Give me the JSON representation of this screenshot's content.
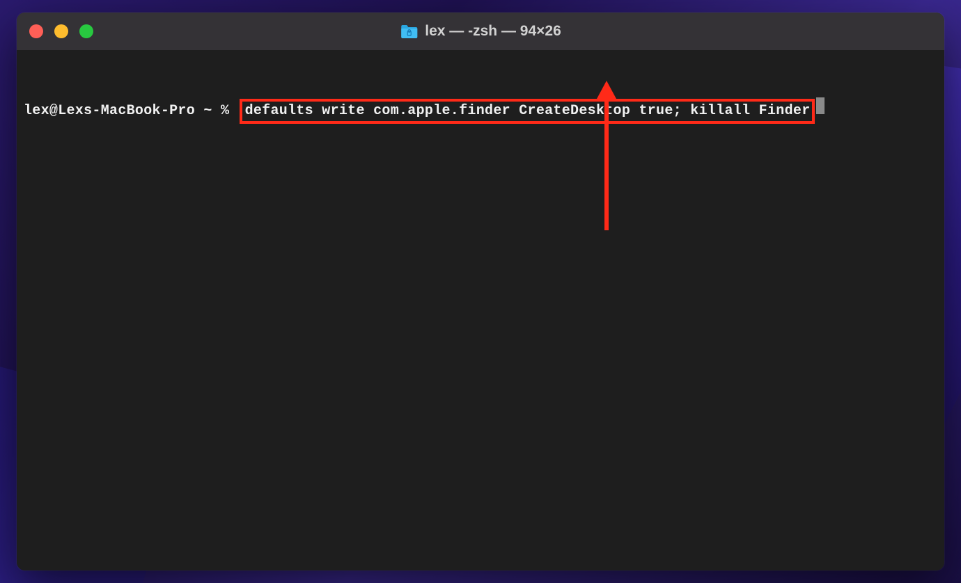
{
  "window": {
    "title": "lex — -zsh — 94×26"
  },
  "terminal": {
    "prompt": "lex@Lexs-MacBook-Pro ~ % ",
    "command": "defaults write com.apple.finder CreateDesktop true; killall Finder"
  },
  "colors": {
    "close": "#ff5f57",
    "minimize": "#febc2e",
    "maximize": "#28c840",
    "highlight": "#ff2a18"
  }
}
